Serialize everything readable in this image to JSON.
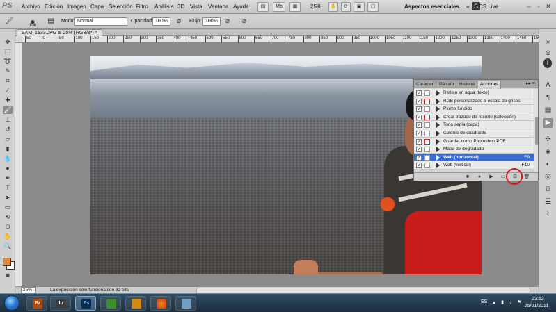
{
  "menubar": {
    "logo": "PS",
    "items": [
      "Archivo",
      "Edición",
      "Imagen",
      "Capa",
      "Selección",
      "Filtro",
      "Análisis",
      "3D",
      "Vista",
      "Ventana",
      "Ayuda"
    ],
    "zoom": "25%",
    "workspace": "Aspectos esenciales",
    "cslive": "CS Live"
  },
  "options": {
    "brush_size": "108",
    "mode_label": "Modo:",
    "mode_value": "Normal",
    "opacity_label": "Opacidad:",
    "opacity_value": "100%",
    "flow_label": "Flujo:",
    "flow_value": "100%"
  },
  "document": {
    "tab_title": "SAM_1933.JPG al 25% (RGB/8*) *",
    "zoom_field": "25%",
    "status": "La exposición sólo funciona con 32 bits"
  },
  "ruler": {
    "labels": [
      "50",
      "0",
      "50",
      "100",
      "150",
      "200",
      "250",
      "300",
      "350",
      "400",
      "450",
      "500",
      "550",
      "600",
      "650",
      "700",
      "750",
      "800",
      "850",
      "900",
      "950",
      "1000",
      "1050",
      "1100",
      "1150",
      "1200",
      "1250",
      "1300",
      "1350",
      "1400",
      "1450",
      "1500"
    ]
  },
  "actions_panel": {
    "tabs": [
      "Carácter",
      "Párrafo",
      "Historia",
      "Acciones"
    ],
    "active_tab": "Acciones",
    "items": [
      {
        "label": "Reflejo en agua (texto)",
        "key": "",
        "checked": true,
        "dialog": false,
        "selected": false
      },
      {
        "label": "RGB personalizado a escala de grises",
        "key": "",
        "checked": true,
        "dialog": true,
        "selected": false
      },
      {
        "label": "Plomo fundido",
        "key": "",
        "checked": true,
        "dialog": false,
        "selected": false
      },
      {
        "label": "Crear trazado de recorte (selección)",
        "key": "",
        "checked": true,
        "dialog": true,
        "selected": false
      },
      {
        "label": "Tono sepia (capa)",
        "key": "",
        "checked": true,
        "dialog": false,
        "selected": false
      },
      {
        "label": "Colores de cuadrante",
        "key": "",
        "checked": true,
        "dialog": false,
        "selected": false
      },
      {
        "label": "Guardar como Photoshop PDF",
        "key": "",
        "checked": true,
        "dialog": true,
        "selected": false
      },
      {
        "label": "Mapa de degradado",
        "key": "",
        "checked": true,
        "dialog": false,
        "selected": false
      },
      {
        "label": "Web (horizontal)",
        "key": "F9",
        "checked": true,
        "dialog": false,
        "selected": true
      },
      {
        "label": "Web (vertical)",
        "key": "F10",
        "checked": true,
        "dialog": false,
        "selected": false
      }
    ]
  },
  "taskbar": {
    "apps": [
      "Br",
      "Lr",
      "Ps",
      "",
      "",
      "",
      ""
    ],
    "lang": "ES",
    "time": "23:52",
    "date": "25/01/2011"
  }
}
